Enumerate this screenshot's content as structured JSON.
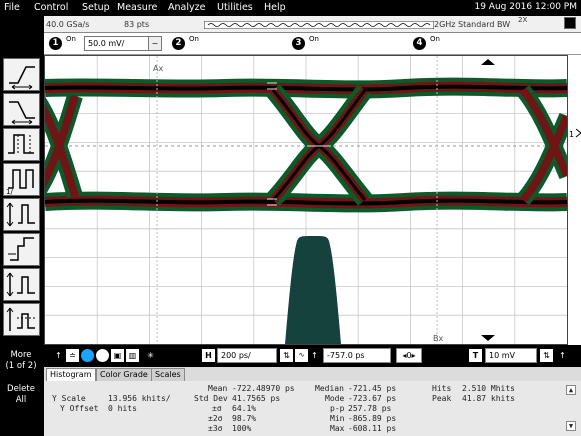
{
  "menu": {
    "items": [
      "File",
      "Control",
      "Setup",
      "Measure",
      "Analyze",
      "Utilities",
      "Help"
    ],
    "datetime": "19 Aug 2016  12:00 PM"
  },
  "info": {
    "sample_rate": "40.0 GSa/s",
    "points": "83 pts",
    "zoom": "2X",
    "bandwidth": "2GHz Standard BW"
  },
  "channels": [
    {
      "num": "1",
      "state": "On",
      "scale": "50.0 mV/"
    },
    {
      "num": "2",
      "state": "On"
    },
    {
      "num": "3",
      "state": "On"
    },
    {
      "num": "4",
      "state": "On"
    }
  ],
  "markers": {
    "ax": "Ax",
    "bx": "Bx"
  },
  "left_toolbar": {
    "more": "More\n(1 of 2)",
    "delete": "Delete\nAll"
  },
  "controls": {
    "h_label": "H",
    "time_scale": "200 ps/",
    "position": "-757.0 ps",
    "t_label": "T",
    "trigger_level": "10 mV",
    "zero": "0"
  },
  "tabs": [
    "Histogram",
    "Color Grade",
    "Scales"
  ],
  "measurements": {
    "y_scale_label": "Y Scale",
    "y_scale_value": "13.956 khits/",
    "y_offset_label": "Y Offset",
    "y_offset_value": "0 hits",
    "mean_label": "Mean",
    "mean_value": "-722.48970 ps",
    "std_label": "Std Dev",
    "std_value": "41.7565 ps",
    "s1_label": "±σ",
    "s1_value": "64.1%",
    "s2_label": "±2σ",
    "s2_value": "98.7%",
    "s3_label": "±3σ",
    "s3_value": "100%",
    "median_label": "Median",
    "median_value": "-721.45 ps",
    "mode_label": "Mode",
    "mode_value": "-723.67 ps",
    "pp_label": "p-p",
    "pp_value": "257.78 ps",
    "min_label": "Min",
    "min_value": "-865.89 ps",
    "max_label": "Max",
    "max_value": "-608.11 ps",
    "hits_label": "Hits",
    "hits_value": "2.510 Mhits",
    "peak_label": "Peak",
    "peak_value": "41.87 khits"
  },
  "colors": {
    "eye_red": "#8b1a1a",
    "eye_green": "#1f8a3a",
    "histogram": "#15423c"
  }
}
